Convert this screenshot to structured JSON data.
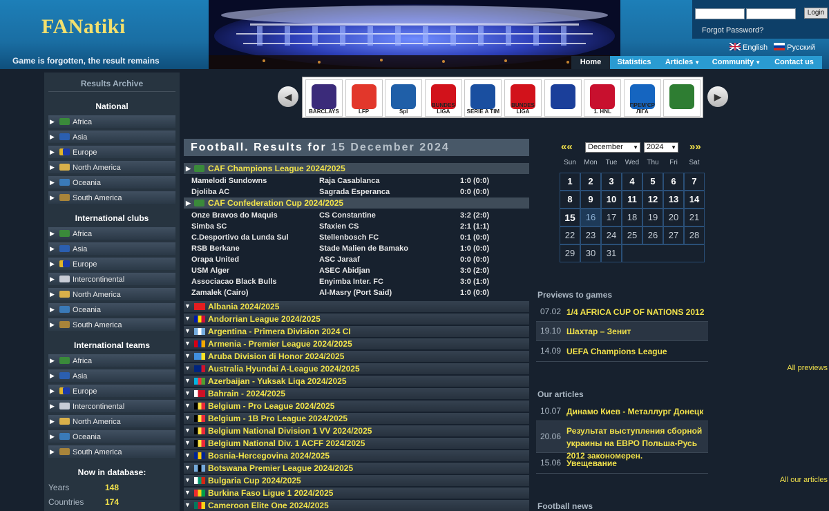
{
  "header": {
    "logo": "FANatiki",
    "slogan": "Game is forgotten, the result remains",
    "login_button": "Login",
    "forgot_password": "Forgot Password?",
    "languages": [
      {
        "label": "English"
      },
      {
        "label": "Русский"
      }
    ],
    "nav": [
      {
        "label": "Home"
      },
      {
        "label": "Statistics"
      },
      {
        "label": "Articles"
      },
      {
        "label": "Community"
      },
      {
        "label": "Contact us"
      }
    ]
  },
  "sidebar": {
    "archive_title": "Results Archive",
    "groups": [
      {
        "title": "National",
        "items": [
          "Africa",
          "Asia",
          "Europe",
          "North America",
          "Oceania",
          "South America"
        ]
      },
      {
        "title": "International clubs",
        "items": [
          "Africa",
          "Asia",
          "Europe",
          "Intercontinental",
          "North America",
          "Oceania",
          "South America"
        ]
      },
      {
        "title": "International teams",
        "items": [
          "Africa",
          "Asia",
          "Europe",
          "Intercontinental",
          "North America",
          "Oceania",
          "South America"
        ]
      }
    ],
    "database": {
      "title": "Now in database:",
      "rows": [
        {
          "label": "Years",
          "value": "148"
        },
        {
          "label": "Countries",
          "value": "174"
        }
      ]
    }
  },
  "leagues": [
    {
      "name": "Premier League",
      "short": "BARCLAYS",
      "color": "#3b2b7a"
    },
    {
      "name": "LFP",
      "short": "LFP",
      "color": "#e2372b"
    },
    {
      "name": "Scottish Premier League",
      "short": "Spl",
      "color": "#1f5fa8"
    },
    {
      "name": "Bundesliga",
      "short": "BUNDES LIGA",
      "color": "#d2121b"
    },
    {
      "name": "Serie A TIM",
      "short": "SERIE A TIM",
      "color": "#1a4fa0"
    },
    {
      "name": "Bundesliga",
      "short": "BUNDES LIGA",
      "color": "#d2121b"
    },
    {
      "name": "Russian league",
      "short": "",
      "color": "#1b3f9a"
    },
    {
      "name": "T-Com 1. HNL",
      "short": "1. HNL",
      "color": "#c8102e"
    },
    {
      "name": "Ukrainian Premier League",
      "short": "ПРЕМ'ЄР ЛІГА",
      "color": "#1565c0"
    },
    {
      "name": "Ukraine emblem",
      "short": "",
      "color": "#2e7d32"
    }
  ],
  "results": {
    "title_prefix": "Football. Results for",
    "date": "15 December 2024",
    "cups": [
      {
        "name": "CAF Champions League 2024/2025",
        "matches": [
          {
            "home": "Mamelodi Sundowns",
            "away": "Raja Casablanca",
            "score": "1:0 (0:0)"
          },
          {
            "home": "Djoliba AC",
            "away": "Sagrada Esperanca",
            "score": "0:0 (0:0)"
          }
        ]
      },
      {
        "name": "CAF Confederation Cup 2024/2025",
        "matches": [
          {
            "home": "Onze Bravos do Maquis",
            "away": "CS Constantine",
            "score": "3:2 (2:0)"
          },
          {
            "home": "Simba SC",
            "away": "Sfaxien CS",
            "score": "2:1 (1:1)"
          },
          {
            "home": "C.Desportivo da Lunda Sul",
            "away": "Stellenbosch FC",
            "score": "0:1 (0:0)"
          },
          {
            "home": "RSB Berkane",
            "away": "Stade Malien de Bamako",
            "score": "1:0 (0:0)"
          },
          {
            "home": "Orapa United",
            "away": "ASC Jaraaf",
            "score": "0:0 (0:0)"
          },
          {
            "home": "USM Alger",
            "away": "ASEC Abidjan",
            "score": "3:0 (2:0)"
          },
          {
            "home": "Associacao Black Bulls",
            "away": "Enyimba Inter. FC",
            "score": "3:0 (1:0)"
          },
          {
            "home": "Zamalek (Cairo)",
            "away": "Al-Masry (Port Said)",
            "score": "1:0 (0:0)"
          }
        ]
      }
    ],
    "leagues": [
      {
        "name": "Albania 2024/2025",
        "flag": [
          "#e41e20",
          "#e41e20"
        ]
      },
      {
        "name": "Andorrian League 2024/2025",
        "flag": [
          "#0018a8",
          "#fedf00",
          "#d0103a"
        ]
      },
      {
        "name": "Argentina - Primera Division 2024 CI",
        "flag": [
          "#74acdf",
          "#ffffff",
          "#74acdf"
        ]
      },
      {
        "name": "Armenia - Premier League 2024/2025",
        "flag": [
          "#d90012",
          "#0033a0",
          "#f2a800"
        ]
      },
      {
        "name": "Aruba Division di Honor 2024/2025",
        "flag": [
          "#418fde",
          "#418fde",
          "#fbe122"
        ]
      },
      {
        "name": "Australia Hyundai A-League 2024/2025",
        "flag": [
          "#00247d",
          "#00247d",
          "#cf142b"
        ]
      },
      {
        "name": "Azerbaijan - Yuksak Liqa 2024/2025",
        "flag": [
          "#00b5e2",
          "#ef3340",
          "#509e2f"
        ]
      },
      {
        "name": "Bahrain - 2024/2025",
        "flag": [
          "#ffffff",
          "#ce1126",
          "#ce1126"
        ]
      },
      {
        "name": "Belgium - Pro League 2024/2025",
        "flag": [
          "#000000",
          "#fae042",
          "#ed2939"
        ]
      },
      {
        "name": "Belgium - 1B Pro League 2024/2025",
        "flag": [
          "#000000",
          "#fae042",
          "#ed2939"
        ]
      },
      {
        "name": "Belgium National Division 1 VV 2024/2025",
        "flag": [
          "#000000",
          "#fae042",
          "#ed2939"
        ]
      },
      {
        "name": "Belgium National Div. 1 ACFF 2024/2025",
        "flag": [
          "#000000",
          "#fae042",
          "#ed2939"
        ]
      },
      {
        "name": "Bosnia-Hercegovina 2024/2025",
        "flag": [
          "#002395",
          "#fecb00",
          "#002395"
        ]
      },
      {
        "name": "Botswana Premier League 2024/2025",
        "flag": [
          "#75aadb",
          "#000000",
          "#75aadb"
        ]
      },
      {
        "name": "Bulgaria Cup 2024/2025",
        "flag": [
          "#ffffff",
          "#00966e",
          "#d62612"
        ]
      },
      {
        "name": "Burkina Faso Ligue 1 2024/2025",
        "flag": [
          "#ef2b2d",
          "#fcd116",
          "#009e49"
        ]
      },
      {
        "name": "Cameroon Elite One 2024/2025",
        "flag": [
          "#007a5e",
          "#ce1126",
          "#fcd116"
        ]
      }
    ]
  },
  "calendar": {
    "prev": "««",
    "next": "»»",
    "month": "December",
    "year": "2024",
    "weekdays": [
      "Sun",
      "Mon",
      "Tue",
      "Wed",
      "Thu",
      "Fri",
      "Sat"
    ],
    "weeks": [
      [
        "1",
        "2",
        "3",
        "4",
        "5",
        "6",
        "7"
      ],
      [
        "8",
        "9",
        "10",
        "11",
        "12",
        "13",
        "14"
      ],
      [
        "15",
        "16",
        "17",
        "18",
        "19",
        "20",
        "21"
      ],
      [
        "22",
        "23",
        "24",
        "25",
        "26",
        "27",
        "28"
      ],
      [
        "29",
        "30",
        "31"
      ]
    ]
  },
  "previews": {
    "title": "Previews to games",
    "items": [
      {
        "date": "07.02",
        "text": "1/4 AFRICA CUP OF NATIONS 2012"
      },
      {
        "date": "19.10",
        "text": "Шахтар – Зенит"
      },
      {
        "date": "14.09",
        "text": "UEFA Champions League"
      }
    ],
    "more": "All previews"
  },
  "articles": {
    "title": "Our articles",
    "items": [
      {
        "date": "10.07",
        "text": "Динамо Киев - Металлург Донецк"
      },
      {
        "date": "20.06",
        "text": "Результат выступления сборной украины на ЕВРО Польша-Русь 2012 закономерен."
      },
      {
        "date": "15.06",
        "text": "Увещевание"
      }
    ],
    "more": "All our articles"
  },
  "news": {
    "title": "Football news"
  },
  "colors": {
    "accent": "#f1e14b",
    "nav": "#2a9bd2",
    "background": "#17212e"
  }
}
